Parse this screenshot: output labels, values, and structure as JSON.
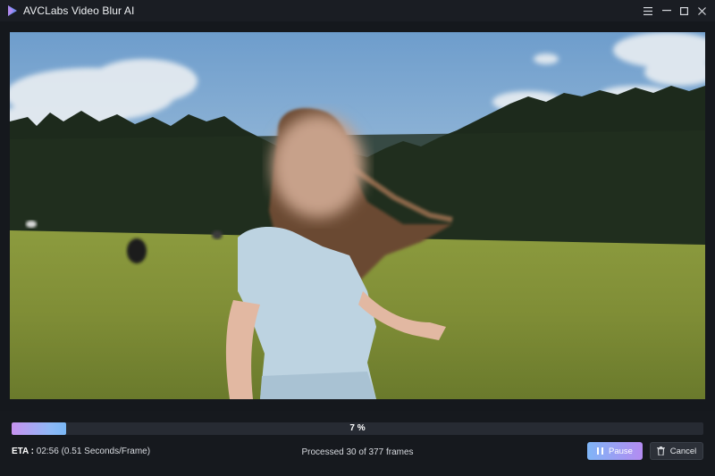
{
  "window": {
    "title": "AVCLabs Video Blur AI",
    "controls": [
      "menu-icon",
      "minimize-icon",
      "maximize-icon",
      "close-icon"
    ]
  },
  "progress": {
    "percent_label": "7 %",
    "fraction": 0.079
  },
  "status": {
    "eta_label": "ETA :",
    "eta_value": "02:56 (0.51 Seconds/Frame)",
    "processed": "Processed 30 of 377 frames"
  },
  "actions": {
    "pause_label": "Pause",
    "cancel_label": "Cancel"
  },
  "colors": {
    "accent_start": "#7fb5f6",
    "accent_end": "#b48bf2",
    "background": "#14171c"
  }
}
